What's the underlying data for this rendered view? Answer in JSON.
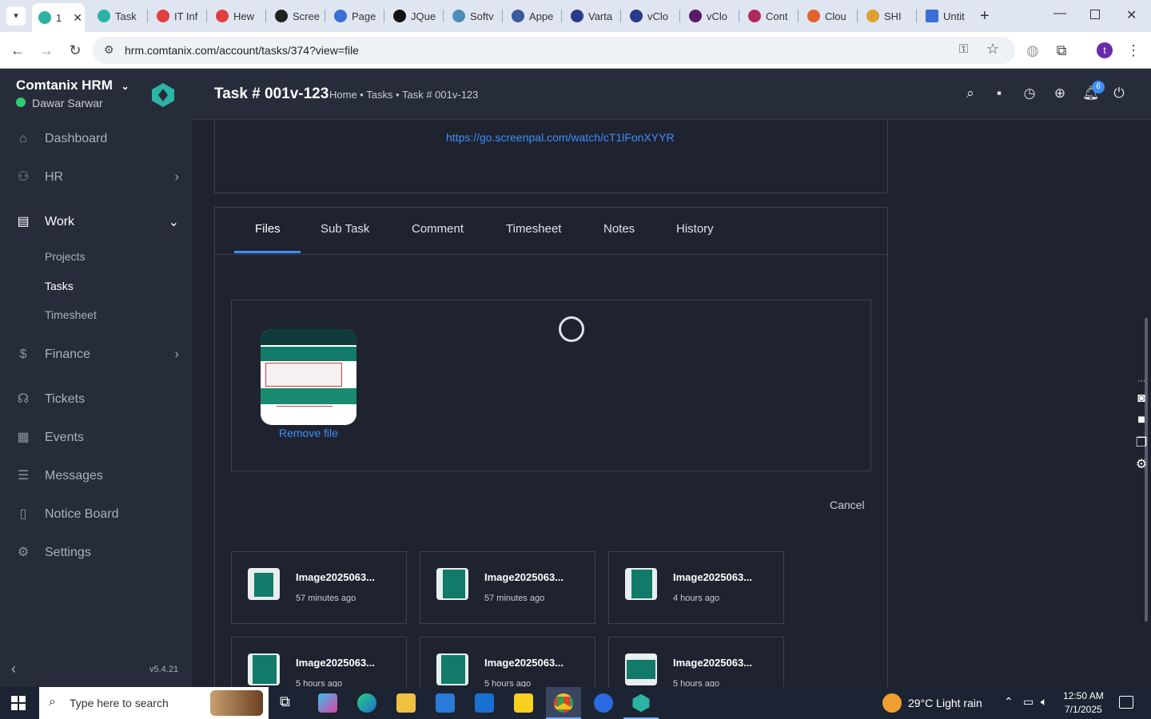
{
  "browser": {
    "tabs": [
      {
        "label": "1",
        "active": true
      },
      {
        "label": "Task"
      },
      {
        "label": "IT Inf"
      },
      {
        "label": "Hew"
      },
      {
        "label": "Scree"
      },
      {
        "label": "Page"
      },
      {
        "label": "JQue"
      },
      {
        "label": "Softv"
      },
      {
        "label": "Appe"
      },
      {
        "label": "Varta"
      },
      {
        "label": "vClo"
      },
      {
        "label": "vClo"
      },
      {
        "label": "Cont"
      },
      {
        "label": "Clou"
      },
      {
        "label": "SHI"
      },
      {
        "label": "Untit"
      }
    ],
    "url": "hrm.comtanix.com/account/tasks/374?view=file",
    "profile_initial": "t"
  },
  "sidebar": {
    "brand": "Comtanix HRM",
    "user": "Dawar Sarwar",
    "items": [
      {
        "label": "Dashboard",
        "icon": "home-icon"
      },
      {
        "label": "HR",
        "icon": "users-icon"
      },
      {
        "label": "Work",
        "icon": "briefcase-icon"
      },
      {
        "label": "Finance",
        "icon": "dollar-icon"
      },
      {
        "label": "Tickets",
        "icon": "headset-icon"
      },
      {
        "label": "Events",
        "icon": "calendar-icon"
      },
      {
        "label": "Messages",
        "icon": "message-icon"
      },
      {
        "label": "Notice Board",
        "icon": "clipboard-icon"
      },
      {
        "label": "Settings",
        "icon": "gear-icon"
      }
    ],
    "work_sub": [
      "Projects",
      "Tasks",
      "Timesheet"
    ],
    "version": "v5.4.21"
  },
  "header": {
    "title": "Task # 001v-123",
    "breadcrumb": "Home • Tasks • Task # 001v-123",
    "notif_count": "6"
  },
  "task": {
    "link": "https://go.screenpal.com/watch/cT1lFonXYYR",
    "tabs": [
      "Files",
      "Sub Task",
      "Comment",
      "Timesheet",
      "Notes",
      "History"
    ],
    "remove_file": "Remove file",
    "cancel": "Cancel",
    "files": [
      {
        "name": "Image2025063...",
        "time": "57 minutes ago"
      },
      {
        "name": "Image2025063...",
        "time": "57 minutes ago"
      },
      {
        "name": "Image2025063...",
        "time": "4 hours ago"
      },
      {
        "name": "Image2025063...",
        "time": "5 hours ago"
      },
      {
        "name": "Image2025063...",
        "time": "5 hours ago"
      },
      {
        "name": "Image2025063...",
        "time": "5 hours ago"
      }
    ]
  },
  "taskbar": {
    "search_placeholder": "Type here to search",
    "weather": "29°C  Light rain",
    "time": "12:50 AM",
    "date": "7/1/2025"
  }
}
